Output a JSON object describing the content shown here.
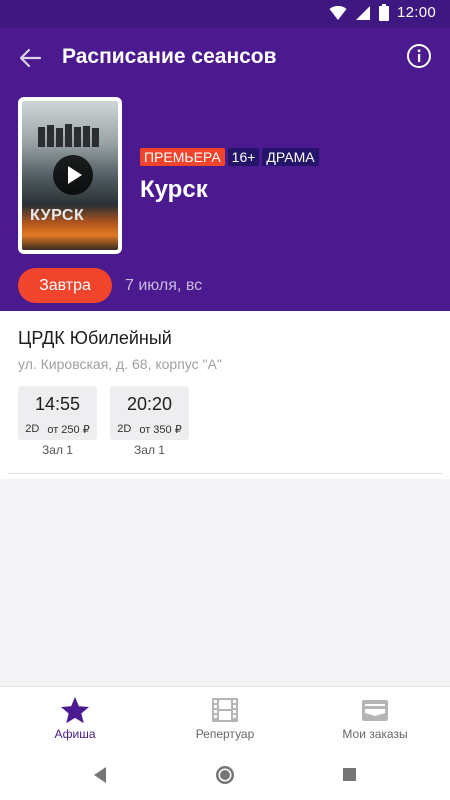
{
  "status_bar": {
    "time": "12:00"
  },
  "app_bar": {
    "title": "Расписание сеансов"
  },
  "movie": {
    "poster_title": "КУРСК",
    "badges": {
      "premiere": "ПРЕМЬЕРА",
      "age": "16+",
      "genre": "ДРАМА"
    },
    "title": "Курск"
  },
  "date": {
    "selected_label": "Завтра",
    "date_text": "7 июля, вс"
  },
  "cinema": {
    "name": "ЦРДК Юбилейный",
    "address": "ул. Кировская, д. 68, корпус \"А\"",
    "sessions": [
      {
        "time": "14:55",
        "format": "2D",
        "price": "от 250 ₽",
        "hall": "Зал 1"
      },
      {
        "time": "20:20",
        "format": "2D",
        "price": "от 350 ₽",
        "hall": "Зал 1"
      }
    ]
  },
  "bottom_nav": {
    "items": [
      {
        "label": "Афиша",
        "icon": "star-icon",
        "active": true
      },
      {
        "label": "Репертуар",
        "icon": "film-icon",
        "active": false
      },
      {
        "label": "Мои заказы",
        "icon": "wallet-icon",
        "active": false
      }
    ]
  },
  "colors": {
    "primary": "#4a1a8e",
    "accent": "#f0442c",
    "badge_dark": "#24146a"
  }
}
